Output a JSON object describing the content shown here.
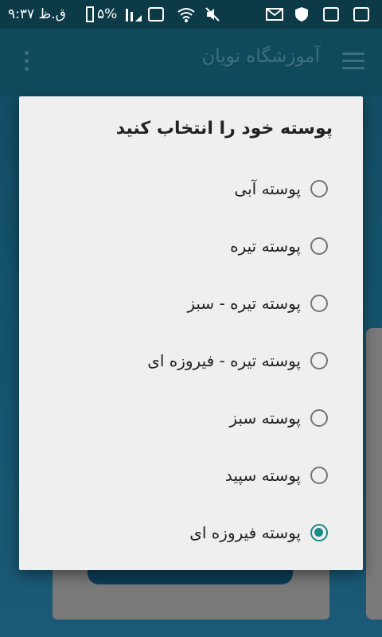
{
  "status_bar": {
    "time": "۹:۳۷ ق.ظ",
    "battery": "۵%",
    "icons": [
      "signal-icon",
      "wifi-icon",
      "mute-icon",
      "mail-icon",
      "shield-icon",
      "app-icon",
      "image-icon"
    ]
  },
  "app_bar": {
    "title": "آموزشگاه نویان",
    "menu_icon": "hamburger-icon",
    "more_icon": "more-vert-icon"
  },
  "dialog": {
    "title": "پوسته خود را انتخاب کنید",
    "options": [
      {
        "label": "پوسته آبی",
        "checked": false
      },
      {
        "label": "پوسته تیره",
        "checked": false
      },
      {
        "label": "پوسته تیره - سبز",
        "checked": false
      },
      {
        "label": "پوسته تیره - فیروزه ای",
        "checked": false
      },
      {
        "label": "پوسته سبز",
        "checked": false
      },
      {
        "label": "پوسته سپید",
        "checked": false
      },
      {
        "label": "پوسته فیروزه ای",
        "checked": true
      }
    ],
    "accent_color": "#1a8a85"
  }
}
